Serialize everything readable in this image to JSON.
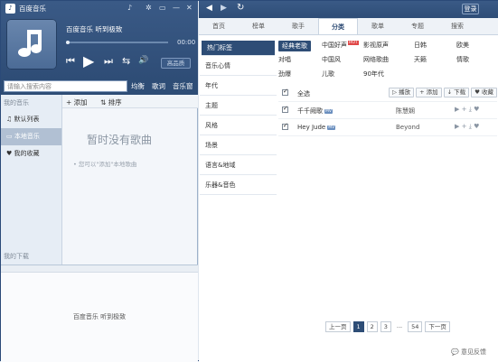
{
  "app": {
    "title": "百度音乐",
    "window_controls": [
      "♪",
      "✲",
      "▭",
      "—",
      "✕"
    ]
  },
  "player": {
    "song": "百度音乐  听到极致",
    "time": "00:00",
    "quality": "高品质",
    "controls": [
      "⏮",
      "▶",
      "⏭",
      "⇆",
      "🔊"
    ]
  },
  "search": {
    "placeholder": "请输入搜索内容",
    "buttons": [
      "均衡",
      "歌词",
      "音乐窗"
    ]
  },
  "sidebar": {
    "header": "我的音乐",
    "items": [
      {
        "label": "默认列表",
        "icon": "♫"
      },
      {
        "label": "本地音乐",
        "icon": "▭"
      },
      {
        "label": "我的收藏",
        "icon": "♥"
      }
    ],
    "download": "我的下载"
  },
  "list": {
    "add": "+ 添加",
    "sort": "⇅ 排序",
    "empty_title": "暂时没有歌曲",
    "empty_tip": "• 您可以\"添加\"本地歌曲"
  },
  "mini": {
    "text": "百度音乐  听到极致"
  },
  "nav": {
    "login": "登录",
    "back": "◀",
    "forward": "▶",
    "refresh": "↻",
    "tabs": [
      "首页",
      "榜单",
      "歌手",
      "分类",
      "歌单",
      "专题",
      "搜索"
    ],
    "active": 3
  },
  "categories": [
    "热门标签",
    "音乐心情",
    "年代",
    "主题",
    "风格",
    "场景",
    "语言&地域",
    "乐器&音色"
  ],
  "tags": [
    {
      "label": "经典老歌",
      "sel": true
    },
    {
      "label": "中国好声",
      "hot": "HOT"
    },
    {
      "label": "影视原声"
    },
    {
      "label": "日韩"
    },
    {
      "label": "欧美"
    },
    {
      "label": "对唱"
    },
    {
      "label": "中国风"
    },
    {
      "label": "网络歌曲"
    },
    {
      "label": "天籁"
    },
    {
      "label": "情歌"
    },
    {
      "label": "劲爆"
    },
    {
      "label": "儿歌"
    },
    {
      "label": "90年代"
    }
  ],
  "table": {
    "select_all": "全选",
    "buttons": [
      "▷ 播放",
      "+ 添加",
      "↓ 下载",
      "♥ 收藏"
    ],
    "mv": "MV",
    "songs": [
      {
        "name": "千千阙歌",
        "artist": "陈慧娴"
      },
      {
        "name": "Hey Jude",
        "artist": "Beyond"
      }
    ]
  },
  "pager": {
    "prev": "上一页",
    "pages": [
      "1",
      "2",
      "3",
      "...",
      "54"
    ],
    "next": "下一页"
  },
  "feedback": "💬 意见反馈"
}
